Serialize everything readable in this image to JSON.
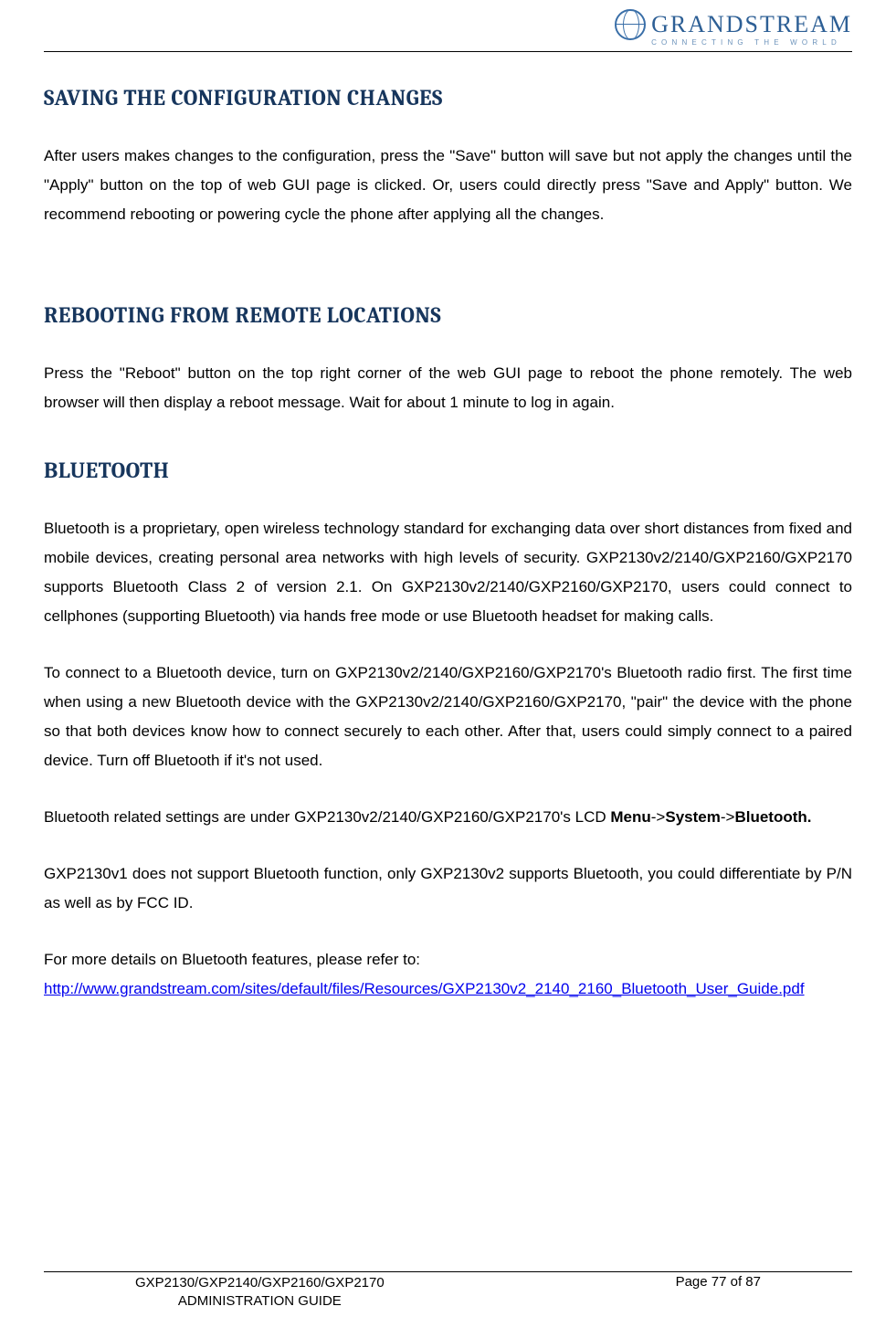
{
  "header": {
    "brand": "GRANDSTREAM",
    "tagline": "CONNECTING THE WORLD"
  },
  "sections": {
    "s1": {
      "title": "SAVING THE CONFIGURATION CHANGES",
      "p1": "After users makes changes to the configuration, press the \"Save\" button will save but not apply the changes until the \"Apply\" button on the top of web GUI page is clicked. Or, users could directly press \"Save and Apply\" button. We recommend rebooting or powering cycle the phone after applying all the changes."
    },
    "s2": {
      "title": "REBOOTING FROM REMOTE LOCATIONS",
      "p1": "Press the \"Reboot\" button on the top right corner of the web GUI page to reboot the phone remotely. The web browser will then display a reboot message. Wait for about 1 minute to log in again."
    },
    "s3": {
      "title": "BLUETOOTH",
      "p1": "Bluetooth is a proprietary, open wireless technology standard for exchanging data over short distances from fixed and mobile devices, creating personal area networks with high levels of security. GXP2130v2/2140/GXP2160/GXP2170 supports Bluetooth Class 2 of version 2.1. On GXP2130v2/2140/GXP2160/GXP2170, users could connect to cellphones (supporting Bluetooth) via hands free mode or use Bluetooth headset for making calls.",
      "p2": "To connect to a Bluetooth device, turn on GXP2130v2/2140/GXP2160/GXP2170's Bluetooth radio first. The first time when using a new Bluetooth device with the GXP2130v2/2140/GXP2160/GXP2170, \"pair\" the device with the phone so that both devices know how to connect securely to each other. After that, users could simply connect to a paired device. Turn off Bluetooth if it's not used.",
      "p3_prefix": "Bluetooth related settings are under GXP2130v2/2140/GXP2160/GXP2170's LCD ",
      "p3_menu": "Menu",
      "p3_arrow1": "->",
      "p3_system": "System",
      "p3_arrow2": "->",
      "p3_bluetooth": "Bluetooth.",
      "p4": "GXP2130v1 does not support Bluetooth function, only GXP2130v2 supports Bluetooth, you could differentiate by P/N as well as by FCC ID.",
      "p5": "For more details on Bluetooth features, please refer to:",
      "link": "http://www.grandstream.com/sites/default/files/Resources/GXP2130v2_2140_2160_Bluetooth_User_Guide.pdf"
    }
  },
  "footer": {
    "doc_line1": "GXP2130/GXP2140/GXP2160/GXP2170",
    "doc_line2": "ADMINISTRATION GUIDE",
    "page": "Page 77 of 87"
  }
}
